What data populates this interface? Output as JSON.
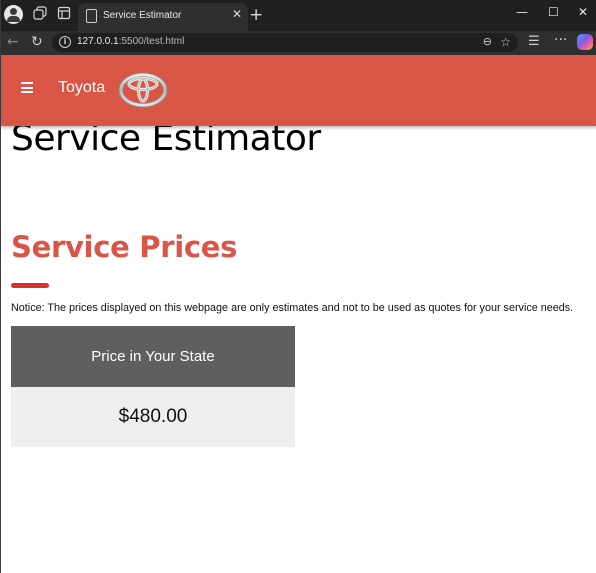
{
  "browser": {
    "tab": {
      "title": "Service Estimator"
    },
    "address": {
      "host": "127.0.0.1",
      "rest": ":5500/test.html"
    }
  },
  "header": {
    "brand": "Toyota"
  },
  "main": {
    "page_title": "Service Estimator",
    "section_title": "Service Prices",
    "notice": "Notice: The prices displayed on this webpage are only estimates and not to be used as quotes for your service needs.",
    "price_table": {
      "header": "Price in Your State",
      "value": "$480.00"
    }
  },
  "colors": {
    "header_bg": "#d95545",
    "accent_red": "#d9322a",
    "table_header_bg": "#5f5f5f",
    "table_cell_bg": "#efefef"
  },
  "icons": [
    "profile-icon",
    "workspaces-icon",
    "tab-actions-icon",
    "document-icon",
    "close-icon",
    "new-tab-icon",
    "minimize-icon",
    "maximize-icon",
    "window-close-icon",
    "back-icon",
    "refresh-icon",
    "info-icon",
    "zoom-icon",
    "favorite-star-icon",
    "favorites-icon",
    "more-icon",
    "copilot-icon",
    "hamburger-menu-icon",
    "toyota-logo"
  ]
}
